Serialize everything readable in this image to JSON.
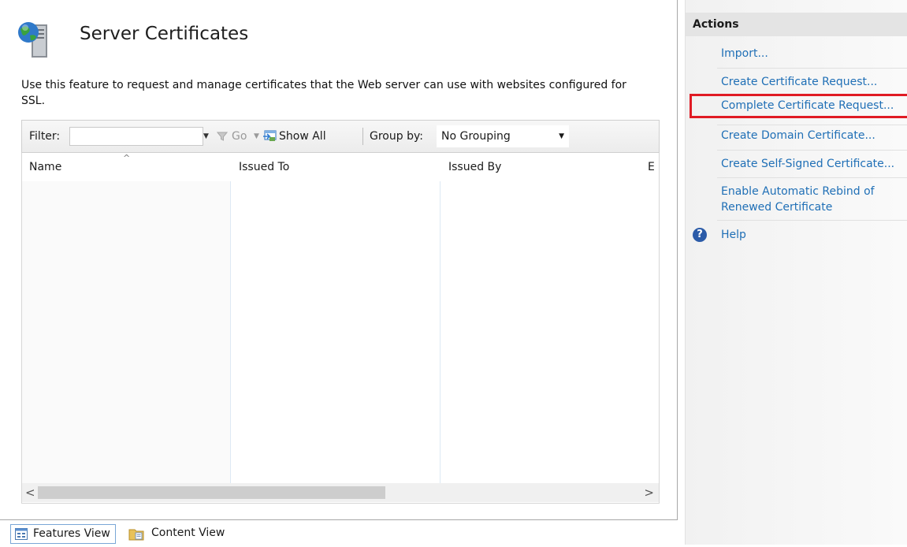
{
  "header": {
    "title": "Server Certificates",
    "icon": "server-globe-icon",
    "description": "Use this feature to request and manage certificates that the Web server can use with websites configured for SSL."
  },
  "toolbar": {
    "filter_label": "Filter:",
    "filter_value": "",
    "go_label": "Go",
    "show_all_label": "Show All",
    "group_by_label": "Group by:",
    "group_by_value": "No Grouping"
  },
  "table": {
    "columns": [
      "Name",
      "Issued To",
      "Issued By",
      "E"
    ],
    "sort_column": "Name",
    "rows": []
  },
  "tabs": {
    "features_view": "Features View",
    "content_view": "Content View",
    "active": "Features View"
  },
  "actions": {
    "title": "Actions",
    "items": [
      "Import...",
      "Create Certificate Request...",
      "Complete Certificate Request...",
      "Create Domain Certificate...",
      "Create Self-Signed Certificate...",
      "Enable Automatic Rebind of",
      "Renewed Certificate"
    ],
    "highlighted_item": "Complete Certificate Request...",
    "help_label": "Help"
  },
  "colors": {
    "link": "#1f6fb6",
    "highlight": "#e01b24",
    "help_icon": "#2b5ba8"
  }
}
